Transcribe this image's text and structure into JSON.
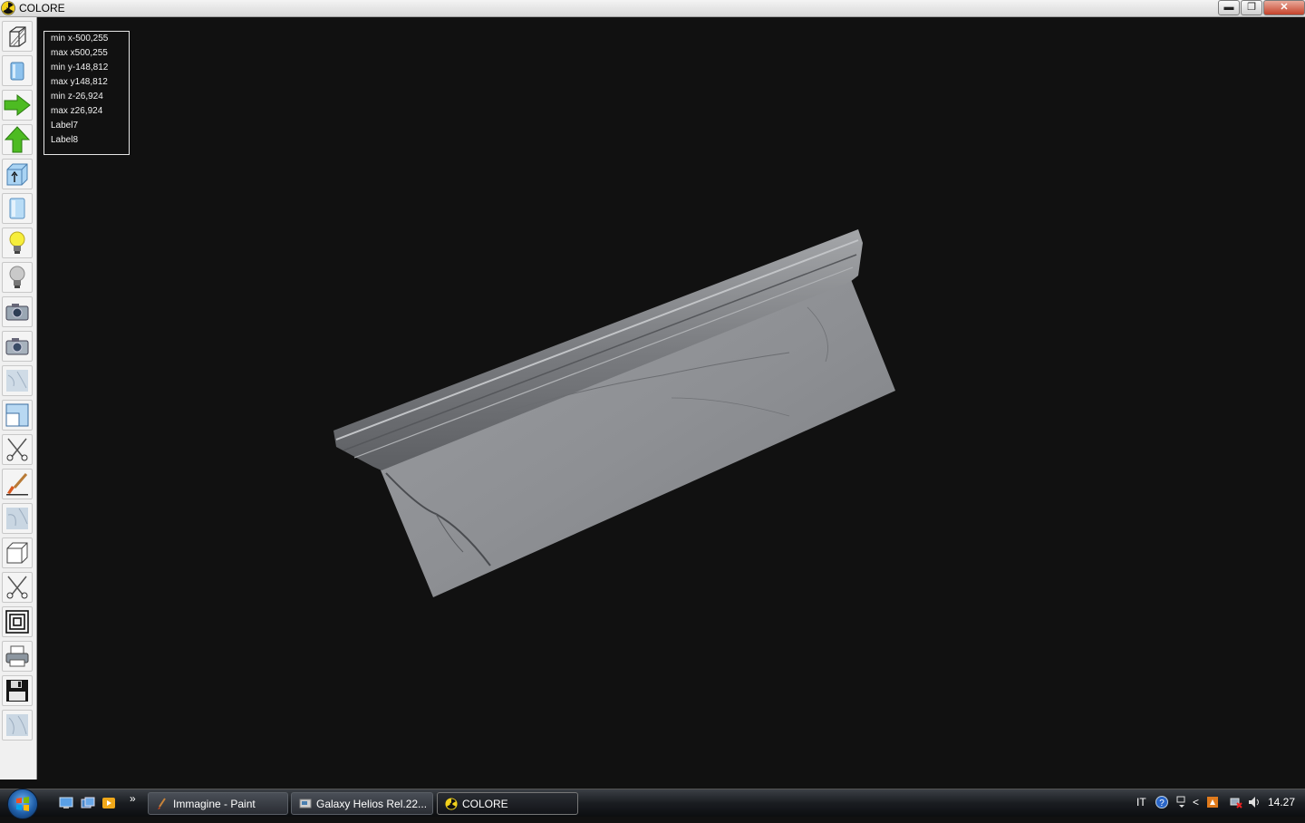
{
  "window": {
    "title": "COLORE",
    "controls": {
      "minimize": "▬",
      "maximize": "❐",
      "close": "✕"
    }
  },
  "toolbar": {
    "tools": [
      {
        "name": "wireframe-box-icon"
      },
      {
        "name": "cylinder-view-icon"
      },
      {
        "name": "green-arrow-right-icon"
      },
      {
        "name": "green-arrow-up-icon"
      },
      {
        "name": "box-arrow-up-icon"
      },
      {
        "name": "cylinder-icon"
      },
      {
        "name": "lightbulb-on-icon"
      },
      {
        "name": "lightbulb-off-icon"
      },
      {
        "name": "camera-icon"
      },
      {
        "name": "camera-alt-icon"
      },
      {
        "name": "marble-texture-icon"
      },
      {
        "name": "frame-corner-icon"
      },
      {
        "name": "scissors-icon"
      },
      {
        "name": "paintbrush-icon"
      },
      {
        "name": "marble-texture-alt-icon"
      },
      {
        "name": "cube-icon"
      },
      {
        "name": "scissors-alt-icon"
      },
      {
        "name": "concentric-squares-icon"
      },
      {
        "name": "printer-icon"
      },
      {
        "name": "floppy-disk-icon"
      },
      {
        "name": "marble-texture-third-icon"
      }
    ]
  },
  "info": {
    "min_x": "min x-500,255",
    "max_x": "max x500,255",
    "min_y": "min y-148,812",
    "max_y": "max y148,812",
    "min_z": "min z-26,924",
    "max_z": "max z26,924",
    "label7": "Label7",
    "label8": "Label8"
  },
  "taskbar": {
    "overflow": "»",
    "buttons": [
      {
        "label": "Immagine - Paint"
      },
      {
        "label": "Galaxy Helios  Rel.22..."
      },
      {
        "label": "COLORE"
      }
    ],
    "language": "IT",
    "clock": "14.27",
    "tray_chevron": "<"
  },
  "colors": {
    "viewport_bg": "#111111",
    "accent_green": "#3fae1f",
    "marble": "#9a9ca0"
  }
}
